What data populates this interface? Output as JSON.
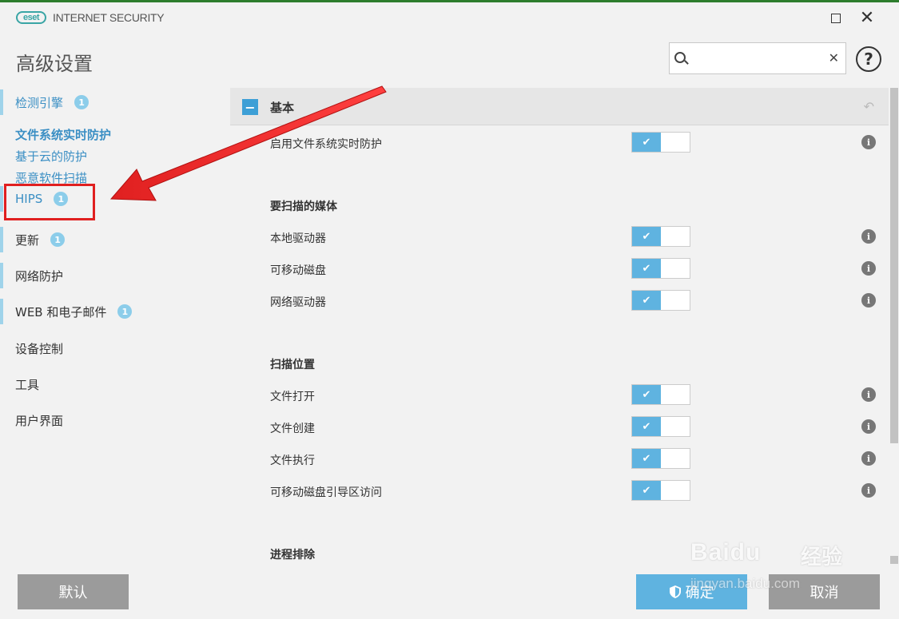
{
  "app": {
    "logo_text": "eset",
    "product_name": "INTERNET SECURITY"
  },
  "page_title": "高级设置",
  "search": {
    "placeholder": "",
    "value": ""
  },
  "sidebar": {
    "items": [
      {
        "label": "检测引擎",
        "badge": "1"
      },
      {
        "label": "HIPS",
        "badge": "1"
      },
      {
        "label": "更新",
        "badge": "1"
      },
      {
        "label": "网络防护"
      },
      {
        "label": "WEB 和电子邮件",
        "badge": "1"
      },
      {
        "label": "设备控制"
      },
      {
        "label": "工具"
      },
      {
        "label": "用户界面"
      }
    ],
    "sub_items": [
      {
        "label": "文件系统实时防护"
      },
      {
        "label": "基于云的防护"
      },
      {
        "label": "恶意软件扫描"
      }
    ]
  },
  "section": {
    "title": "基本",
    "enable_label": "启用文件系统实时防护",
    "groups": [
      {
        "title": "要扫描的媒体",
        "rows": [
          "本地驱动器",
          "可移动磁盘",
          "网络驱动器"
        ]
      },
      {
        "title": "扫描位置",
        "rows": [
          "文件打开",
          "文件创建",
          "文件执行",
          "可移动磁盘引导区访问"
        ]
      },
      {
        "title": "进程排除"
      }
    ]
  },
  "buttons": {
    "default": "默认",
    "ok": "确定",
    "cancel": "取消"
  },
  "watermark": {
    "logo": "Baidu",
    "jingyan": "经验",
    "url": "jingyan.baidu.com"
  },
  "colors": {
    "accent": "#5fb3e0",
    "annotation": "#e02020",
    "sidebar_link": "#3b8fc4"
  }
}
